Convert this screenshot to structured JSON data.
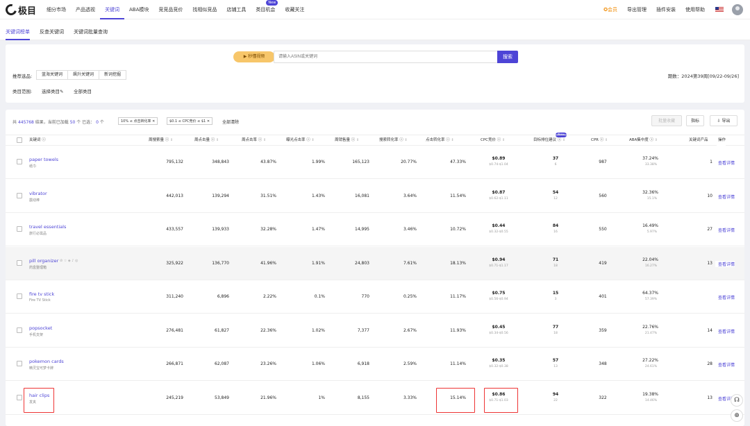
{
  "brand": {
    "name": "极目"
  },
  "nav": [
    {
      "label": "细分市场"
    },
    {
      "label": "产品透视"
    },
    {
      "label": "关键词"
    },
    {
      "label": "ABA模块"
    },
    {
      "label": "竞竞品竞价"
    },
    {
      "label": "找相似竞品"
    },
    {
      "label": "店铺工具"
    },
    {
      "label": "类目机会"
    },
    {
      "label": "收藏关注"
    }
  ],
  "nav_badge": "New",
  "right_nav": {
    "member": "✪会员",
    "export_mgmt": "导出管理",
    "plugin": "插件安装",
    "help": "使用帮助"
  },
  "subtabs": [
    "关键词榜单",
    "反查关键词",
    "关键词批量查询"
  ],
  "search": {
    "video_label": "秒懂视频",
    "placeholder": "请输入ASIN或关键词",
    "button": "搜索"
  },
  "filters": {
    "recommend_label": "推荐选品:",
    "recommend_tabs": [
      "蓝海关键词",
      "飙升关键词",
      "新词挖掘"
    ],
    "category_label": "类目范围:",
    "category_choose": "选择类目✎",
    "category_all": "全部类目",
    "period": "期数：2024第39周[09/22-09/26]"
  },
  "toolbar": {
    "summary_prefix": "共",
    "total": "445768",
    "summary_mid": "结果，当前已加载",
    "loaded": "50",
    "summary_mid2": "个  已选：",
    "selected": "0",
    "summary_suffix": "个",
    "chip1": "10% ≤ 点击转化率 ✕",
    "chip2": "$0.1 ≤ CPC竞价 ≤ $1 ✕",
    "clear_all": "全部清除",
    "bulk_collect": "批量收藏",
    "metrics": "指标",
    "export": "⇩ 导出"
  },
  "columns": {
    "keyword": "关键词 ⓘ",
    "search_volume": "周搜索量 ⓘ",
    "clicks": "周点击量 ⓘ",
    "ctr": "周点击率 ⓘ",
    "impr_ctr": "曝光点击率 ⓘ",
    "sales": "周销售量 ⓘ",
    "search_cvr": "搜索转化率 ⓘ",
    "click_cvr": "点击转化率 ⓘ",
    "cpc": "CPC竞价 ⓘ",
    "rank_suggest": "目标排位建议 ⓘ",
    "cpr": "CPR ⓘ",
    "aba": "ABA集中度 ⓘ",
    "kw_products": "关键词产品",
    "action": "操作",
    "new_badge": "New"
  },
  "rows": [
    {
      "kw": "paper towels",
      "cn": "纸巾",
      "sv": "795,132",
      "clk": "348,843",
      "ctr": "43.87%",
      "ictr": "1.99%",
      "sales": "165,123",
      "scvr": "20.77%",
      "ccvr": "47.33%",
      "cpc": "$0.89",
      "cpc_range": "$0.74-$1.04",
      "rank": "37",
      "rank_sub": "6",
      "cpr": "987",
      "aba": "37.24%",
      "aba_sub": "33.38%",
      "prod": "1",
      "detail": "查看详情"
    },
    {
      "kw": "vibrator",
      "cn": "震动棒",
      "sv": "442,013",
      "clk": "139,294",
      "ctr": "31.51%",
      "ictr": "1.43%",
      "sales": "16,081",
      "scvr": "3.64%",
      "ccvr": "11.54%",
      "cpc": "$0.87",
      "cpc_range": "$0.62-$1.11",
      "rank": "54",
      "rank_sub": "12",
      "cpr": "560",
      "aba": "32.36%",
      "aba_sub": "15.1%",
      "prod": "10",
      "detail": "查看详情"
    },
    {
      "kw": "travel essentials",
      "cn": "旅行必需品",
      "sv": "433,557",
      "clk": "139,933",
      "ctr": "32.28%",
      "ictr": "1.47%",
      "sales": "14,995",
      "scvr": "3.46%",
      "ccvr": "10.72%",
      "cpc": "$0.44",
      "cpc_range": "$0.32-$0.55",
      "rank": "84",
      "rank_sub": "16",
      "cpr": "550",
      "aba": "16.49%",
      "aba_sub": "5.97%",
      "prod": "27",
      "detail": "查看详情"
    },
    {
      "kw": "pill organizer",
      "cn": "药盒整理箱",
      "sv": "325,922",
      "clk": "136,770",
      "ctr": "41.96%",
      "ictr": "1.91%",
      "sales": "24,803",
      "scvr": "7.61%",
      "ccvr": "18.13%",
      "cpc": "$0.94",
      "cpc_range": "$0.71-$1.17",
      "rank": "71",
      "rank_sub": "18",
      "cpr": "419",
      "aba": "22.04%",
      "aba_sub": "16.27%",
      "prod": "13",
      "detail": "查看详情"
    },
    {
      "kw": "fire tv stick",
      "cn": "Fire TV Stick",
      "sv": "311,240",
      "clk": "6,896",
      "ctr": "2.22%",
      "ictr": "0.1%",
      "sales": "770",
      "scvr": "0.25%",
      "ccvr": "11.17%",
      "cpc": "$0.75",
      "cpc_range": "$0.56-$0.94",
      "rank": "15",
      "rank_sub": "3",
      "cpr": "401",
      "aba": "64.37%",
      "aba_sub": "57.39%",
      "prod": "",
      "detail": "查看详情"
    },
    {
      "kw": "popsocket",
      "cn": "手机支架",
      "sv": "276,481",
      "clk": "61,827",
      "ctr": "22.36%",
      "ictr": "1.02%",
      "sales": "7,377",
      "scvr": "2.67%",
      "ccvr": "11.93%",
      "cpc": "$0.45",
      "cpc_range": "$0.34-$0.56",
      "rank": "77",
      "rank_sub": "18",
      "cpr": "359",
      "aba": "22.76%",
      "aba_sub": "21.47%",
      "prod": "14",
      "detail": "查看详情"
    },
    {
      "kw": "pokemon cards",
      "cn": "精灵宝可梦卡牌",
      "sv": "266,871",
      "clk": "62,087",
      "ctr": "23.26%",
      "ictr": "1.06%",
      "sales": "6,918",
      "scvr": "2.59%",
      "ccvr": "11.14%",
      "cpc": "$0.35",
      "cpc_range": "$0.32-$0.38",
      "rank": "57",
      "rank_sub": "13",
      "cpr": "348",
      "aba": "27.22%",
      "aba_sub": "24.61%",
      "prod": "28",
      "detail": "查看详情"
    },
    {
      "kw": "hair clips",
      "cn": "发夹",
      "sv": "245,219",
      "clk": "53,849",
      "ctr": "21.96%",
      "ictr": "1%",
      "sales": "8,155",
      "scvr": "3.33%",
      "ccvr": "15.14%",
      "cpc": "$0.86",
      "cpc_range": "$0.71-$1.03",
      "rank": "94",
      "rank_sub": "22",
      "cpr": "322",
      "aba": "19.38%",
      "aba_sub": "14.46%",
      "prod": "13",
      "detail": "查看详情"
    }
  ],
  "colors": {
    "accent": "#4d44d6",
    "member": "#f08a00",
    "highlight_box": "#e33333"
  }
}
